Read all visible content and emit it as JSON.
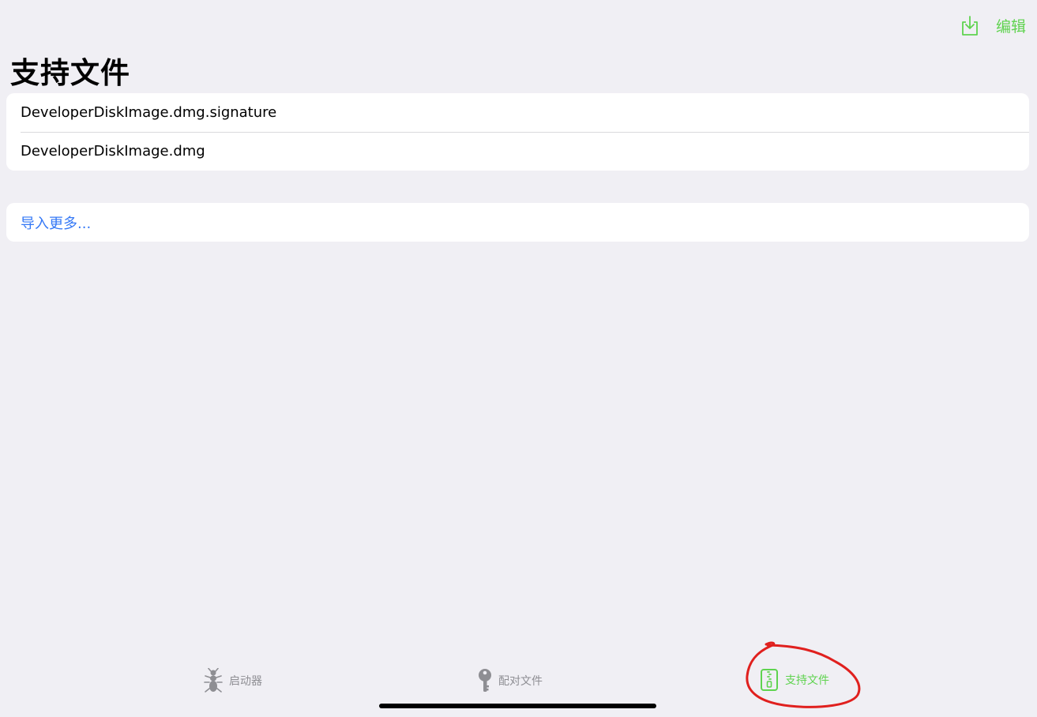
{
  "colors": {
    "accent": "#5fd34f",
    "link": "#3478f6",
    "inactive": "#8e8e93",
    "annotation": "#e0201e"
  },
  "toolbar": {
    "import_icon": "tray-arrow-down-icon",
    "edit_label": "编辑"
  },
  "page_title": "支持文件",
  "files": [
    {
      "name": "DeveloperDiskImage.dmg.signature"
    },
    {
      "name": "DeveloperDiskImage.dmg"
    }
  ],
  "import_more": "导入更多...",
  "tabbar": {
    "tabs": [
      {
        "label": "启动器",
        "icon": "ant-icon",
        "selected": false
      },
      {
        "label": "配对文件",
        "icon": "key-icon",
        "selected": false
      },
      {
        "label": "支持文件",
        "icon": "zipper-file-icon",
        "selected": true
      }
    ]
  }
}
